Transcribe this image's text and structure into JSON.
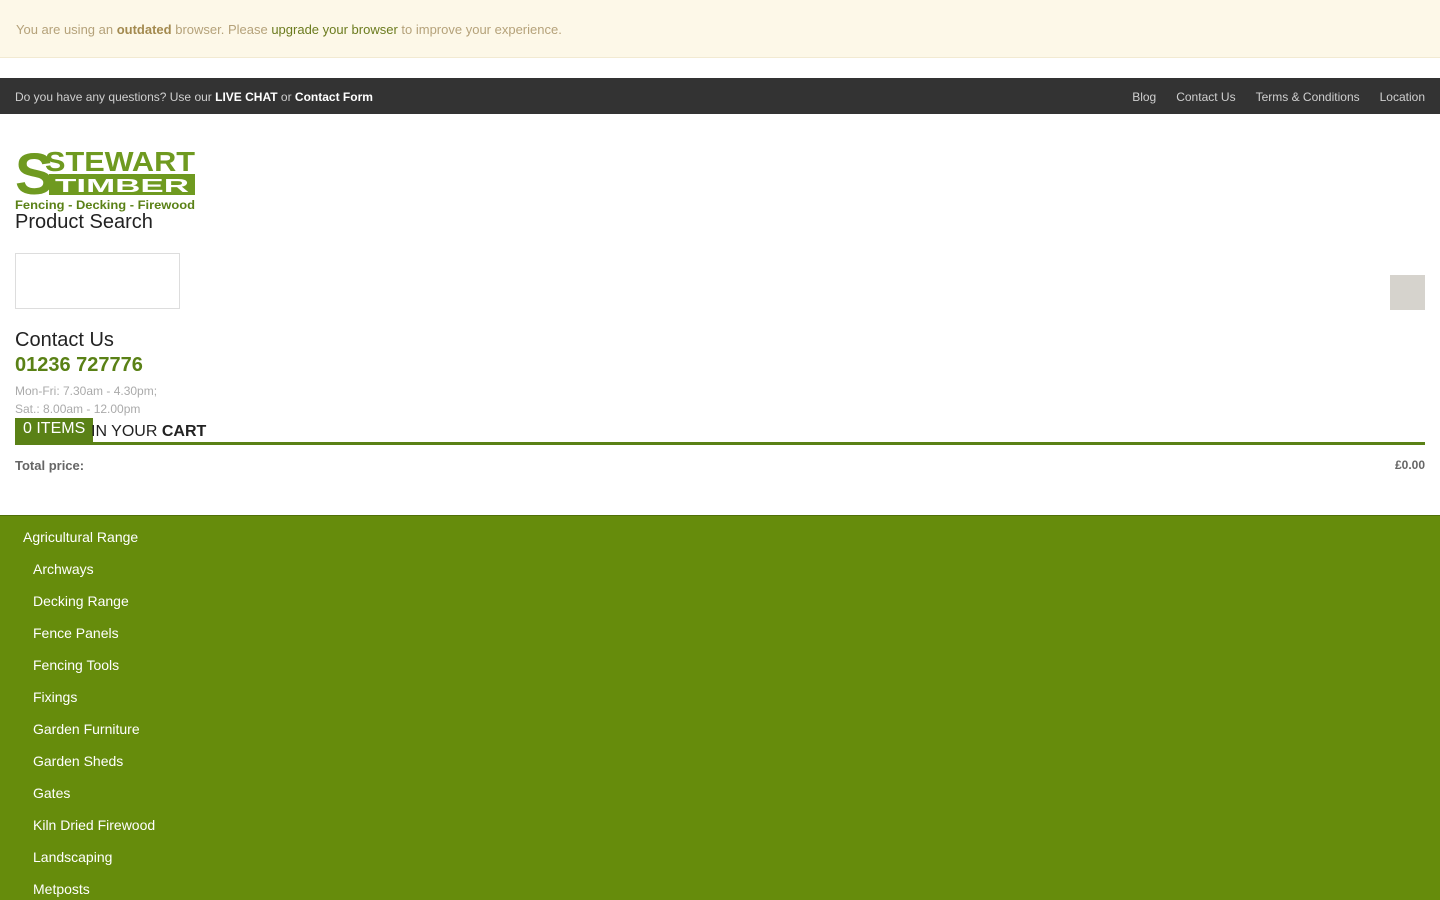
{
  "alert": {
    "prefix": "You are using an ",
    "strong": "outdated",
    "middle": " browser. Please ",
    "link": "upgrade your browser",
    "suffix": " to improve your experience."
  },
  "topbar": {
    "question": "Do you have any questions? Use our ",
    "live_chat": "LIVE CHAT",
    "or": " or ",
    "contact_form": "Contact Form",
    "links": [
      "Blog",
      "Contact Us",
      "Terms & Conditions",
      "Location"
    ]
  },
  "logo": {
    "line1": "STEWART",
    "line2": "TIMBER",
    "tagline": "Fencing - Decking - Firewood"
  },
  "search": {
    "title": "Product Search",
    "placeholder": ""
  },
  "contact": {
    "title": "Contact Us",
    "phone": "01236 727776",
    "hours_weekday": "Mon-Fri: 7.30am - 4.30pm;",
    "hours_saturday": "Sat.: 8.00am - 12.00pm"
  },
  "cart": {
    "items": "0 ITEMS",
    "in_your": "IN YOUR ",
    "cart": "CART",
    "total_label": "Total price:",
    "total_value": "£0.00"
  },
  "menu": {
    "items": [
      "Agricultural Range",
      "Archways",
      "Decking Range",
      "Fence Panels",
      "Fencing Tools",
      "Fixings",
      "Garden Furniture",
      "Garden Sheds",
      "Gates",
      "Kiln Dried Firewood",
      "Landscaping",
      "Metposts"
    ]
  },
  "colors": {
    "brand_green": "#668c0c",
    "dark_green": "#5a8116",
    "topbar_bg": "#333333"
  }
}
